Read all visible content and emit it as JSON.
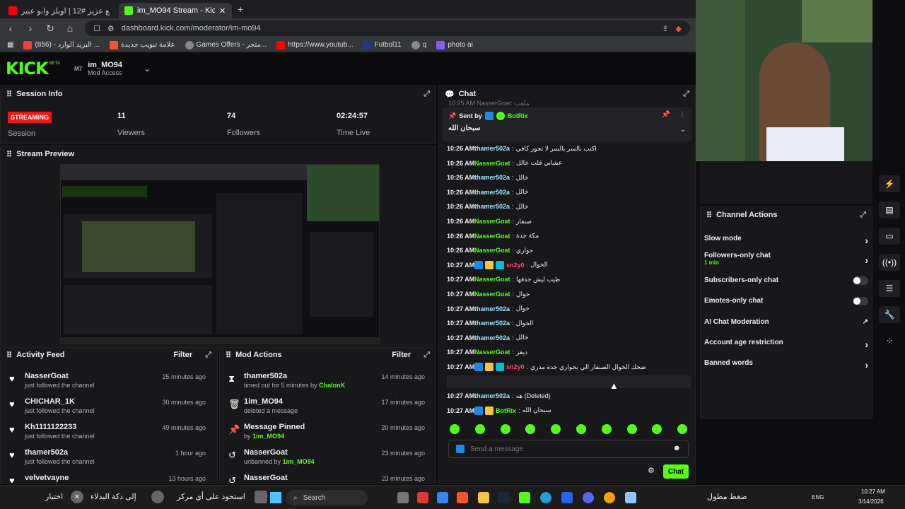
{
  "browser": {
    "tabs": [
      {
        "label": "حروف مع عزيز #12 | اوبلز وابو عبير"
      },
      {
        "label": "im_MO94 Stream - Kick Dash"
      }
    ],
    "new_tab": "+",
    "url": "dashboard.kick.com/moderator/im-mo94",
    "bookmarks": [
      "البريد الوارد - (856) ...",
      "علامة تبويب جديدة",
      "Games Offers - متجر...",
      "https://www.youtub...",
      "Futbol11",
      "q",
      "photo ai"
    ]
  },
  "header": {
    "logo": "KICK",
    "beta": "BETA",
    "channel_name": "im_MO94",
    "access": "Mod Access"
  },
  "session": {
    "title": "Session Info",
    "status": "STREAMING",
    "status_label": "Session",
    "viewers": "11",
    "viewers_label": "Viewers",
    "followers": "74",
    "followers_label": "Followers",
    "time_live": "02:24:57",
    "time_live_label": "Time Live"
  },
  "preview": {
    "title": "Stream Preview"
  },
  "activity": {
    "title": "Activity Feed",
    "filter": "Filter",
    "items": [
      {
        "name": "NasserGoat",
        "sub": "just followed the channel",
        "time": "25 minutes ago"
      },
      {
        "name": "CHICHAR_1K",
        "sub": "just followed the channel",
        "time": "30 minutes ago"
      },
      {
        "name": "Kh1111122233",
        "sub": "just followed the channel",
        "time": "49 minutes ago"
      },
      {
        "name": "thamer502a",
        "sub": "just followed the channel",
        "time": "1 hour ago"
      },
      {
        "name": "velvetvayne",
        "sub": "",
        "time": "13 hours ago"
      }
    ]
  },
  "modactions": {
    "title": "Mod Actions",
    "filter": "Filter",
    "items": [
      {
        "name": "thamer502a",
        "sub": "timed out for 5 minutes by",
        "by": "ChalonK",
        "time": "14 minutes ago"
      },
      {
        "name": "1im_MO94",
        "sub": "deleted a message",
        "by": "",
        "time": "17 minutes ago"
      },
      {
        "name": "Message Pinned",
        "sub": "by",
        "by": "1im_MO94",
        "time": "20 minutes ago"
      },
      {
        "name": "NasserGoat",
        "sub": "unbanned by",
        "by": "1im_MO94",
        "time": "23 minutes ago"
      },
      {
        "name": "NasserGoat",
        "sub": "",
        "by": "",
        "time": "23 minutes ago"
      }
    ]
  },
  "chat": {
    "title": "Chat",
    "top_line": "10:25 AM NasserGoat: ملعب",
    "pinned_by": "Sent by",
    "pinned_user": "BotRix",
    "pinned_msg": "سبحان الله",
    "lines": [
      {
        "t": "10:26 AM",
        "u": "thamer502a",
        "c": "#9be7ff",
        "m": "اكتب بالسر بالسر لا تحور كافي"
      },
      {
        "t": "10:26 AM",
        "u": "NasserGoat",
        "c": "#53fc18",
        "m": "عشاني قلت خالل"
      },
      {
        "t": "10:26 AM",
        "u": "thamer502a",
        "c": "#9be7ff",
        "m": "خالل"
      },
      {
        "t": "10:26 AM",
        "u": "thamer502a",
        "c": "#9be7ff",
        "m": "خالل"
      },
      {
        "t": "10:26 AM",
        "u": "thamer502a",
        "c": "#9be7ff",
        "m": "خالل"
      },
      {
        "t": "10:26 AM",
        "u": "NasserGoat",
        "c": "#53fc18",
        "m": "صنفار"
      },
      {
        "t": "10:26 AM",
        "u": "NasserGoat",
        "c": "#53fc18",
        "m": "مكة جدة"
      },
      {
        "t": "10:26 AM",
        "u": "NasserGoat",
        "c": "#53fc18",
        "m": "حواري"
      },
      {
        "t": "10:27 AM",
        "u": "sn2y0",
        "c": "#ff4d6d",
        "m": "الخوال",
        "badges": 3
      },
      {
        "t": "10:27 AM",
        "u": "NasserGoat",
        "c": "#53fc18",
        "m": "طيب ليش حذفها"
      },
      {
        "t": "10:27 AM",
        "u": "NasserGoat",
        "c": "#53fc18",
        "m": "خوال"
      },
      {
        "t": "10:27 AM",
        "u": "thamer502a",
        "c": "#9be7ff",
        "m": "خوال"
      },
      {
        "t": "10:27 AM",
        "u": "thamer502a",
        "c": "#9be7ff",
        "m": "الخوال"
      },
      {
        "t": "10:27 AM",
        "u": "thamer502a",
        "c": "#9be7ff",
        "m": "خالل"
      },
      {
        "t": "10:27 AM",
        "u": "NasserGoat",
        "c": "#53fc18",
        "m": "ديقز"
      },
      {
        "t": "10:27 AM",
        "u": "sn2y0",
        "c": "#ff4d6d",
        "m": "ضحك الخوال الصنفار الي بحواري جدة مدري",
        "badges": 3
      },
      {
        "t": "10:27 AM",
        "u": "thamer502a",
        "c": "#9be7ff",
        "m": "اسوه (Deleted)"
      },
      {
        "t": "10:27 AM",
        "u": "thamer502a",
        "c": "#9be7ff",
        "m": "هه (Deleted)"
      },
      {
        "t": "10:27 AM",
        "u": "BotRix",
        "c": "#53fc18",
        "m": "سبحان الله",
        "badges": 2
      }
    ],
    "placeholder": "Send a message",
    "send": "Chat"
  },
  "channel_actions": {
    "title": "Channel Actions",
    "items": [
      {
        "label": "Slow mode",
        "sub": "",
        "kind": "chevron"
      },
      {
        "label": "Followers-only chat",
        "sub": "1 min",
        "kind": "chevron"
      },
      {
        "label": "Subscribers-only chat",
        "sub": "",
        "kind": "toggle"
      },
      {
        "label": "Emotes-only chat",
        "sub": "",
        "kind": "toggle"
      },
      {
        "label": "AI Chat Moderation",
        "sub": "",
        "kind": "external"
      },
      {
        "label": "Account age restriction",
        "sub": "",
        "kind": "chevron"
      },
      {
        "label": "Banned words",
        "sub": "",
        "kind": "chevron"
      }
    ]
  },
  "taskbar": {
    "search": "Search",
    "lang": "ENG",
    "time": "10:27 AM",
    "date": "3/14/2026",
    "left_text": "اختيار",
    "left_text2": "إلى دكة البدلاء",
    "left_text3": "استحوذ على أي مركز",
    "right_text": "ضغط مطول"
  },
  "colors": {
    "accent": "#53fc18",
    "streaming": "#e91916"
  }
}
